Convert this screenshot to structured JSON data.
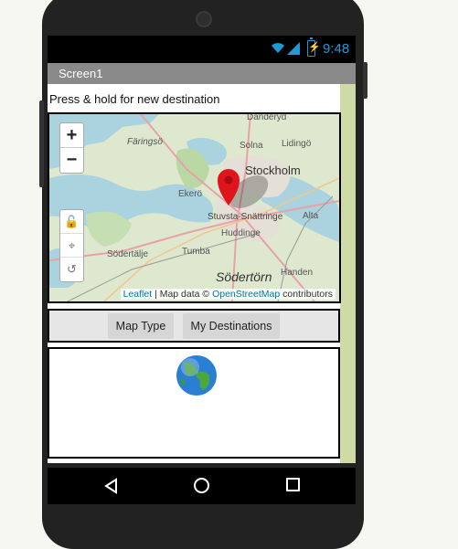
{
  "status": {
    "time": "9:48",
    "accent": "#1e9bd6"
  },
  "title": "Screen1",
  "hint": "Press & hold for new destination",
  "map": {
    "zoom_in": "+",
    "zoom_out": "−",
    "places": [
      "Danderyd",
      "Färingsö",
      "Solna",
      "Lidingö",
      "Stockholm",
      "Ekerö",
      "Stuvsta-Snättringe",
      "Alta",
      "Huddinge",
      "Södertälje",
      "Tumba",
      "Södertörn",
      "Handen"
    ],
    "attribution": {
      "leaflet": "Leaflet",
      "separator": " | Map data © ",
      "osm": "OpenStreetMap",
      "tail": " contributors"
    },
    "marker_color": "#e0151b"
  },
  "buttons": {
    "map_type": "Map Type",
    "my_destinations": "My Destinations"
  },
  "colors": {
    "title_bar": "#8a8a8a",
    "scroll": "#cfdba6",
    "water": "#aad3df"
  }
}
